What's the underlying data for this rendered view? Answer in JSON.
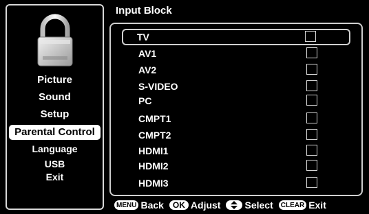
{
  "sidebar": {
    "items": [
      {
        "label": "Picture"
      },
      {
        "label": "Sound"
      },
      {
        "label": "Setup"
      },
      {
        "label": "Parental Control"
      },
      {
        "label": "Language"
      },
      {
        "label": "USB"
      },
      {
        "label": "Exit"
      }
    ],
    "selected_index": 3,
    "icon": "padlock-icon"
  },
  "panel": {
    "title": "Input Block",
    "items": [
      {
        "label": "TV",
        "checked": false
      },
      {
        "label": "AV1",
        "checked": false
      },
      {
        "label": "AV2",
        "checked": false
      },
      {
        "label": "S-VIDEO",
        "checked": false
      },
      {
        "label": "PC",
        "checked": false
      },
      {
        "label": "CMPT1",
        "checked": false
      },
      {
        "label": "CMPT2",
        "checked": false
      },
      {
        "label": "HDMI1",
        "checked": false
      },
      {
        "label": "HDMI2",
        "checked": false
      },
      {
        "label": "HDMI3",
        "checked": false
      }
    ],
    "focused_index": 0
  },
  "footer": {
    "menu_key": "MENU",
    "menu_action": "Back",
    "ok_key": "OK",
    "ok_action": "Adjust",
    "select_action": "Select",
    "clear_key": "CLEAR",
    "clear_action": "Exit"
  },
  "colors": {
    "background": "#000000",
    "text": "#ffffff",
    "selected_bg": "#ffffff",
    "selected_text": "#000000",
    "frame": "#cfcfcf"
  }
}
